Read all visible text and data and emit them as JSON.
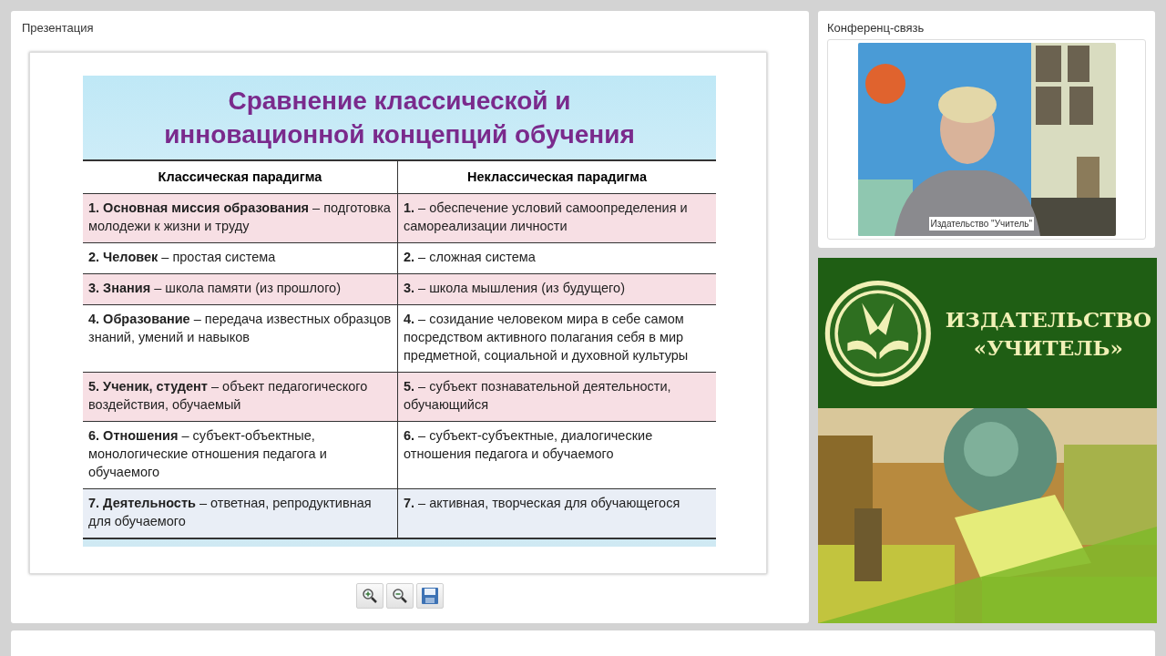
{
  "presentation": {
    "title": "Презентация",
    "slide": {
      "title_lines": [
        "Сравнение классической и",
        "инновационной концепций обучения"
      ],
      "columns": [
        "Классическая парадигма",
        "Неклассическая парадигма"
      ],
      "rows": [
        {
          "color": "#f7dfe4",
          "cells": [
            "**1. Основная миссия образования** – подготовка молодежи к жизни и труду",
            "**1.**  – обеспечение условий самоопределения и самореализации личности"
          ]
        },
        {
          "color": "#ffffff",
          "cells": [
            "**2. Человек** – простая система",
            "**2.** – сложная система"
          ]
        },
        {
          "color": "#f7dfe4",
          "cells": [
            "**3. Знания** – школа памяти (из прошлого)",
            "**3.** – школа мышления (из будущего)"
          ]
        },
        {
          "color": "#ffffff",
          "cells": [
            "**4. Образование** – передача известных образцов знаний, умений и навыков",
            "**4.** – созидание человеком мира в себе самом посредством активного полагания себя в мир предметной, социальной и духовной культуры"
          ]
        },
        {
          "color": "#f7dfe4",
          "cells": [
            "**5. Ученик, студент** – объект педагогического воздействия, обучаемый",
            "**5.** – субъект познавательной деятельности, обучающийся"
          ]
        },
        {
          "color": "#ffffff",
          "cells": [
            "**6. Отношения** – субъект-объектные, монологические отношения педагога и обучаемого",
            "**6.** – субъект-субъектные, диалогические отношения педагога и обучаемого"
          ]
        },
        {
          "color": "#e9eef6",
          "cells": [
            "**7. Деятельность** – ответная, репродуктивная для обучаемого",
            "**7.** – активная, творческая для обучающегося"
          ]
        }
      ]
    },
    "toolbar": [
      {
        "kind": "zoom_in"
      },
      {
        "kind": "zoom_out"
      },
      {
        "kind": "save"
      }
    ]
  },
  "conference": {
    "title": "Конференц-связь",
    "video": {
      "caption": "Издательство \"Учитель\""
    }
  },
  "banner": {
    "lines": [
      "ИЗДАТЕЛЬСТВО",
      "«УЧИТЕЛЬ»"
    ]
  }
}
